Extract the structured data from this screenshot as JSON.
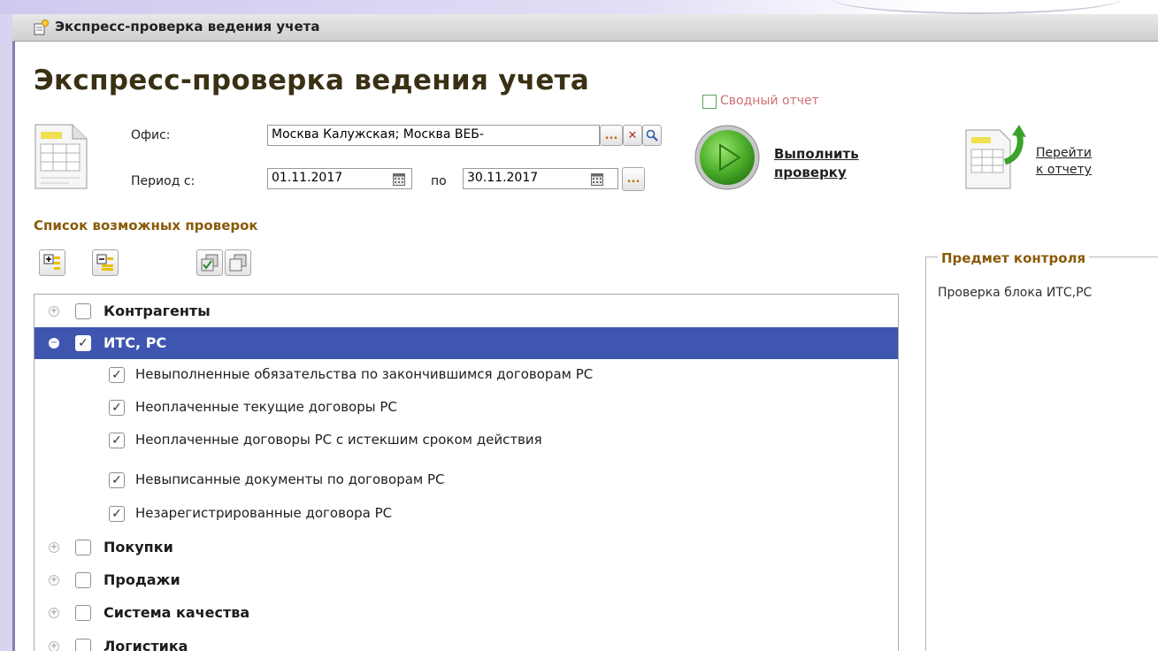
{
  "window": {
    "title": "Экспресс-проверка ведения учета"
  },
  "header": {
    "title": "Экспресс-проверка ведения учета"
  },
  "form": {
    "office_label": "Офис:",
    "office_value": "Москва Калужская; Москва ВЕБ-",
    "period_label": "Период с:",
    "period_from": "01.11.2017",
    "period_to_label": "по",
    "period_to": "30.11.2017",
    "ellipsis": "...",
    "clear_symbol": "✕",
    "search_symbol": "⚲"
  },
  "summary_report": {
    "label": "Сводный отчет",
    "checked": false
  },
  "actions": {
    "run_line1": "Выполнить",
    "run_line2": "проверку",
    "report_line1": "Перейти",
    "report_line2": "к отчету"
  },
  "checks": {
    "title": "Список возможных проверок",
    "groups": [
      {
        "label": "Контрагенты",
        "checked": false,
        "expanded": false,
        "selected": false
      },
      {
        "label": "ИТС, РС",
        "checked": true,
        "expanded": true,
        "selected": true,
        "items": [
          {
            "label": "Невыполненные обязательства по закончившимся договорам РС",
            "checked": true
          },
          {
            "label": "Неоплаченные текущие договоры РС",
            "checked": true
          },
          {
            "label": "Неоплаченные договоры РС с истекшим сроком действия",
            "checked": true
          },
          {
            "label": "Невыписанные документы по договорам РС",
            "checked": true
          },
          {
            "label": "Незарегистрированные договора РС",
            "checked": true
          }
        ]
      },
      {
        "label": "Покупки",
        "checked": false,
        "expanded": false,
        "selected": false
      },
      {
        "label": "Продажи",
        "checked": false,
        "expanded": false,
        "selected": false
      },
      {
        "label": "Система качества",
        "checked": false,
        "expanded": false,
        "selected": false
      },
      {
        "label": "Логистика",
        "checked": false,
        "expanded": false,
        "selected": false
      }
    ]
  },
  "control_subject": {
    "title": "Предмет контроля",
    "text": "Проверка блока ИТС,РС"
  },
  "colors": {
    "selection": "#3f56b0",
    "section_title": "#8a5a0a",
    "play_green": "#4caf2a"
  }
}
